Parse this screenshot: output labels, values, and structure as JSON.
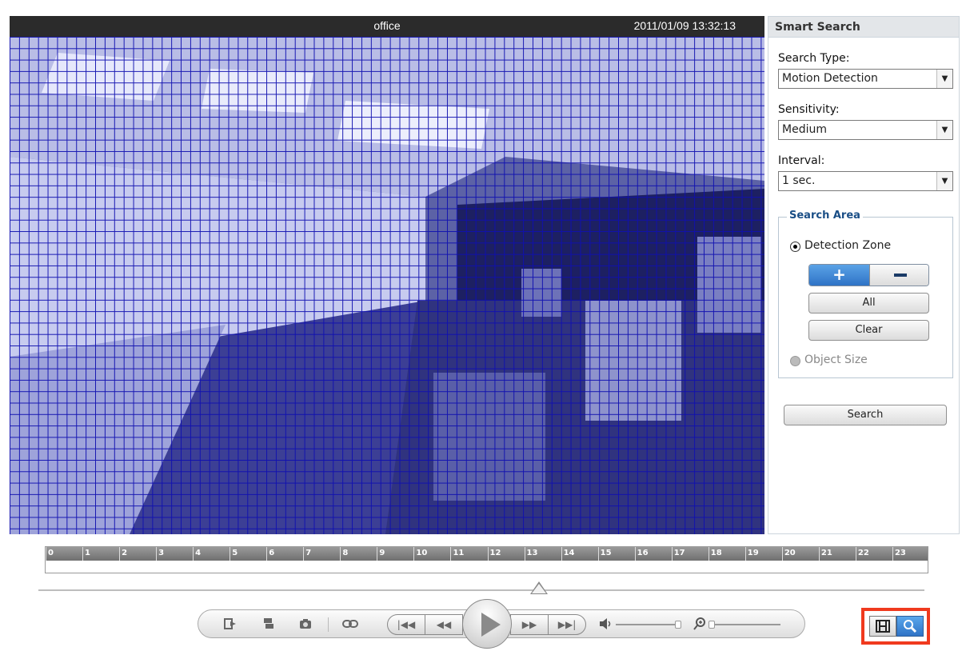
{
  "video": {
    "camera_name": "office",
    "timestamp": "2011/01/09 13:32:13"
  },
  "smart_search": {
    "title": "Smart Search",
    "search_type": {
      "label": "Search Type:",
      "value": "Motion Detection"
    },
    "sensitivity": {
      "label": "Sensitivity:",
      "value": "Medium"
    },
    "interval": {
      "label": "Interval:",
      "value": "1 sec."
    },
    "search_area": {
      "legend": "Search Area",
      "detection_zone_label": "Detection Zone",
      "detection_zone_selected": true,
      "all_label": "All",
      "clear_label": "Clear",
      "object_size_label": "Object Size",
      "object_size_selected": false
    },
    "search_label": "Search"
  },
  "timeline": {
    "hours": [
      "0",
      "1",
      "2",
      "3",
      "4",
      "5",
      "6",
      "7",
      "8",
      "9",
      "10",
      "11",
      "12",
      "13",
      "14",
      "15",
      "16",
      "17",
      "18",
      "19",
      "20",
      "21",
      "22",
      "23"
    ]
  },
  "colors": {
    "grid": "#1010b0",
    "accent_blue": "#2f73c6",
    "highlight": "#f03a1e"
  },
  "icons": {
    "export": "export-icon",
    "download": "download-icon",
    "snapshot": "camera-icon",
    "link": "link-icon",
    "first": "skip-first-icon",
    "rewind": "rewind-icon",
    "play": "play-icon",
    "forward": "fast-forward-icon",
    "last": "skip-last-icon",
    "volume": "volume-icon",
    "zoom": "zoom-icon",
    "film": "film-icon",
    "search": "search-icon"
  }
}
